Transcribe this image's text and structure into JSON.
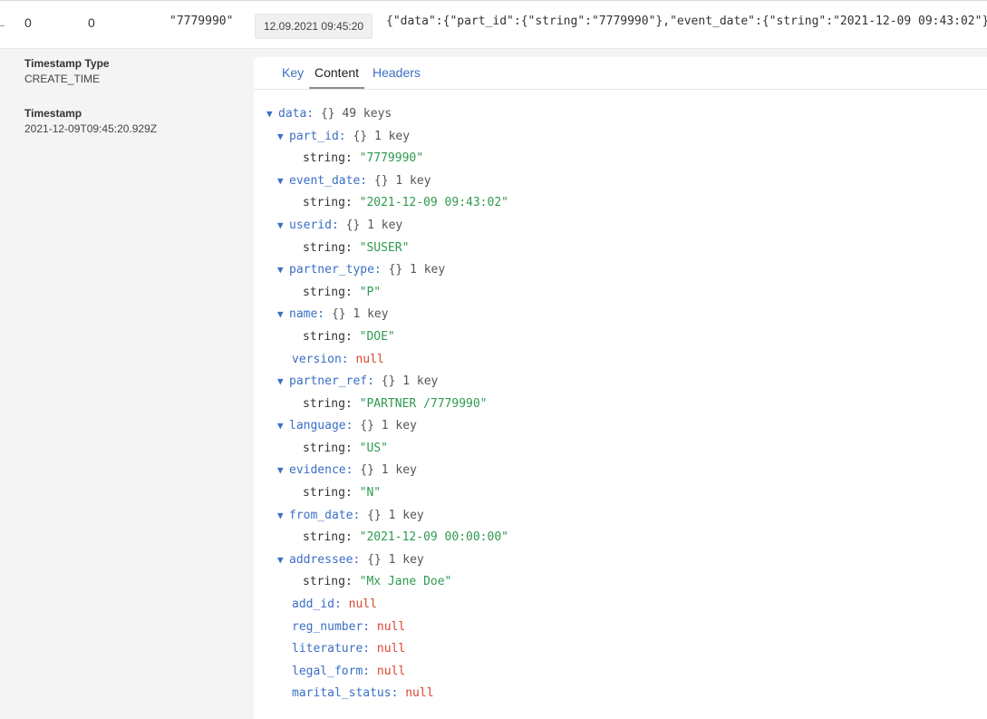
{
  "record": {
    "offset": "0",
    "partition": "0",
    "key": "\"7779990\"",
    "timestamp_badge": "12.09.2021 09:45:20",
    "content_preview": "{\"data\":{\"part_id\":{\"string\":\"7779990\"},\"event_date\":{\"string\":\"2021-12-09 09:43:02\"},"
  },
  "meta": {
    "timestamp_type_label": "Timestamp Type",
    "timestamp_type_value": "CREATE_TIME",
    "timestamp_label": "Timestamp",
    "timestamp_value": "2021-12-09T09:45:20.929Z"
  },
  "tabs": {
    "key": "Key",
    "content": "Content",
    "headers": "Headers"
  },
  "json_tree": {
    "root": {
      "key": "data:",
      "type": "{}",
      "count": "49 keys"
    },
    "part_id": {
      "key": "part_id:",
      "type": "{}",
      "count": "1 key",
      "inner_key": "string:",
      "inner_value": "\"7779990\""
    },
    "event_date": {
      "key": "event_date:",
      "type": "{}",
      "count": "1 key",
      "inner_key": "string:",
      "inner_value": "\"2021-12-09 09:43:02\""
    },
    "userid": {
      "key": "userid:",
      "type": "{}",
      "count": "1 key",
      "inner_key": "string:",
      "inner_value": "\"SUSER\""
    },
    "partner_type": {
      "key": "partner_type:",
      "type": "{}",
      "count": "1 key",
      "inner_key": "string:",
      "inner_value": "\"P\""
    },
    "name": {
      "key": "name:",
      "type": "{}",
      "count": "1 key",
      "inner_key": "string:",
      "inner_value": "\"DOE\""
    },
    "version": {
      "key": "version:",
      "value": "null"
    },
    "partner_ref": {
      "key": "partner_ref:",
      "type": "{}",
      "count": "1 key",
      "inner_key": "string:",
      "inner_value": "\"PARTNER /7779990\""
    },
    "language": {
      "key": "language:",
      "type": "{}",
      "count": "1 key",
      "inner_key": "string:",
      "inner_value": "\"US\""
    },
    "evidence": {
      "key": "evidence:",
      "type": "{}",
      "count": "1 key",
      "inner_key": "string:",
      "inner_value": "\"N\""
    },
    "from_date": {
      "key": "from_date:",
      "type": "{}",
      "count": "1 key",
      "inner_key": "string:",
      "inner_value": "\"2021-12-09 00:00:00\""
    },
    "addressee": {
      "key": "addressee:",
      "type": "{}",
      "count": "1 key",
      "inner_key": "string:",
      "inner_value": "\"Mx Jane Doe\""
    },
    "add_id": {
      "key": "add_id:",
      "value": "null"
    },
    "reg_number": {
      "key": "reg_number:",
      "value": "null"
    },
    "literature": {
      "key": "literature:",
      "value": "null"
    },
    "legal_form": {
      "key": "legal_form:",
      "value": "null"
    },
    "marital_status": {
      "key": "marital_status:",
      "value": "null"
    }
  },
  "icons": {
    "expand": "triangle-down-icon"
  }
}
